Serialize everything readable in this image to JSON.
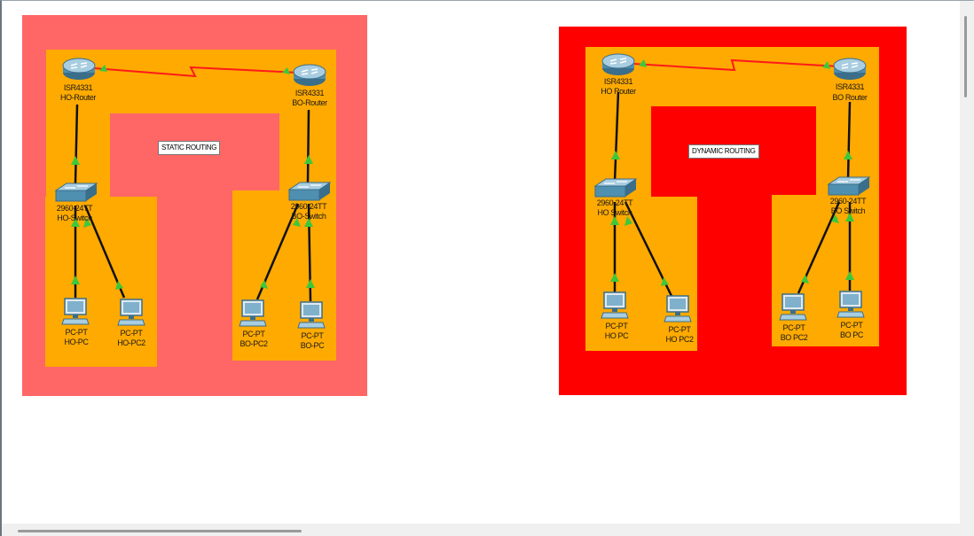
{
  "colors": {
    "static_outer": "#ff6666",
    "dynamic_outer": "#ff0000",
    "inner": "#ffaa00",
    "serial_link": "#ff1a1a",
    "copper_link": "#111111",
    "link_up": "#3cc83c"
  },
  "static": {
    "note": "STATIC ROUTING",
    "ho_router": {
      "model": "ISR4331",
      "name": "HO-Router"
    },
    "bo_router": {
      "model": "ISR4331",
      "name": "BO-Router"
    },
    "ho_switch": {
      "model": "2960-24TT",
      "name": "HO-Switch"
    },
    "bo_switch": {
      "model": "2960-24TT",
      "name": "BO-Switch"
    },
    "ho_pc": {
      "model": "PC-PT",
      "name": "HO-PC"
    },
    "ho_pc2": {
      "model": "PC-PT",
      "name": "HO-PC2"
    },
    "bo_pc2": {
      "model": "PC-PT",
      "name": "BO-PC2"
    },
    "bo_pc": {
      "model": "PC-PT",
      "name": "BO-PC"
    }
  },
  "dynamic": {
    "note": "DYNAMIC ROUTING",
    "ho_router": {
      "model": "ISR4331",
      "name": "HO Router"
    },
    "bo_router": {
      "model": "ISR4331",
      "name": "BO Router"
    },
    "ho_switch": {
      "model": "2960-24TT",
      "name": "HO Switch"
    },
    "bo_switch": {
      "model": "2960-24TT",
      "name": "BO Switch"
    },
    "ho_pc": {
      "model": "PC-PT",
      "name": "HO PC"
    },
    "ho_pc2": {
      "model": "PC-PT",
      "name": "HO PC2"
    },
    "bo_pc2": {
      "model": "PC-PT",
      "name": "BO PC2"
    },
    "bo_pc": {
      "model": "PC-PT",
      "name": "BO PC"
    }
  },
  "icons": {
    "router": "router-icon",
    "switch": "switch-icon",
    "pc": "pc-icon"
  }
}
